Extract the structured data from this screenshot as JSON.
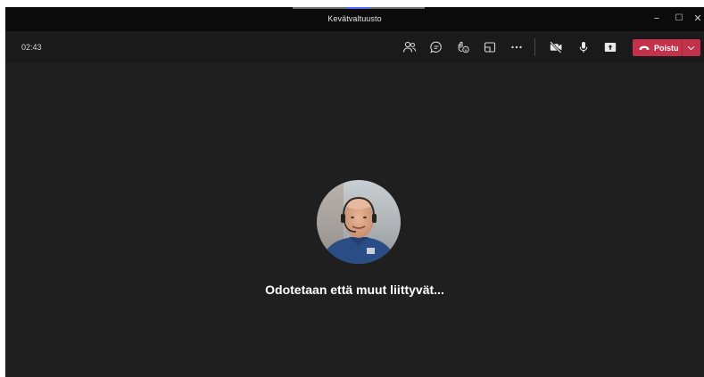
{
  "window": {
    "title": "Kevätvaltuusto",
    "controls": {
      "minimize": "−",
      "maximize": "☐",
      "close": "✕"
    }
  },
  "toolbar": {
    "timer": "02:43",
    "icons": [
      "participants-icon",
      "chat-icon",
      "reactions-icon",
      "rooms-icon",
      "more-options-icon",
      "camera-off-icon",
      "microphone-icon",
      "share-screen-icon"
    ],
    "leave": {
      "label": "Poistu",
      "color": "#c4314b"
    }
  },
  "stage": {
    "waiting_text": "Odotetaan että muut liittyvät..."
  },
  "colors": {
    "background": "#1f1f1f",
    "titlebar": "#0b0b0b",
    "toolbar": "#1a1a1a",
    "accent": "#4f6bed",
    "leave": "#c4314b"
  }
}
